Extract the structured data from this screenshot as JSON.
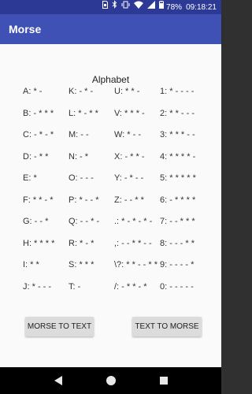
{
  "status_bar": {
    "battery": "78%",
    "time": "09:18:21",
    "icons": [
      "sim-icon",
      "bluetooth-icon",
      "vibrate-icon",
      "wifi-icon",
      "signal-icon",
      "battery-icon"
    ]
  },
  "app_bar": {
    "title": "Morse"
  },
  "heading": "Alphabet",
  "morse_codes": [
    "A: * -",
    "K: - * -",
    "U: * * -",
    "1: * - - - -",
    "B: - * * *",
    "L: * - * *",
    "V: * * * -",
    "2: * * - - -",
    "C: - * - *",
    "M: - -",
    "W: * - -",
    "3: * * * - -",
    "D: - * *",
    "N: - *",
    "X: - * * -",
    "4: * * * * -",
    "E: *",
    "O: - - -",
    "Y: - * - -",
    "5: * * * * *",
    "F: * * - *",
    "P: * - - *",
    "Z: - - * *",
    "6: - * * * *",
    "G: - - *",
    "Q: - - * -",
    ".: * - * - * -",
    "7: - - * * *",
    "H: * * * *",
    "R: * - *",
    ",: - - * * - -",
    "8: - - - * *",
    "I: * *",
    "S: * * *",
    "\\?: * * - - * *",
    "9: - - - - *",
    "J: * - - -",
    "T: -",
    "/: - * * - *",
    "0: - - - - -"
  ],
  "buttons": {
    "morse_to_text": "MORSE TO TEXT",
    "text_to_morse": "TEXT TO MORSE"
  },
  "nav_bar": {
    "icons": [
      "back-icon",
      "home-icon",
      "recents-icon"
    ]
  }
}
